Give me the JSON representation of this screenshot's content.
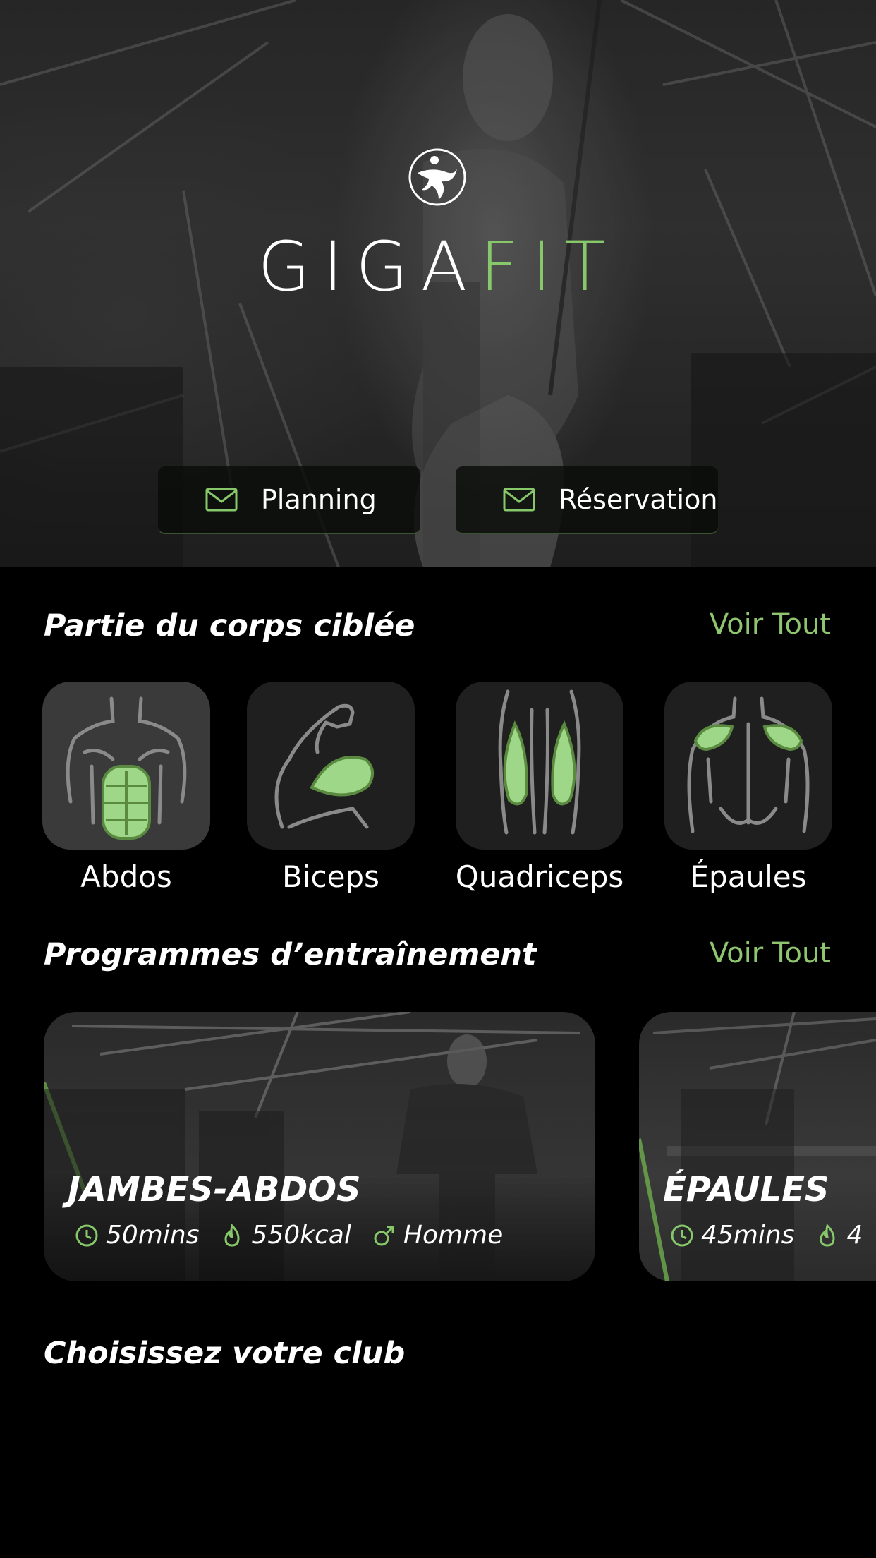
{
  "hero": {
    "brand_part1": "GIGA",
    "brand_part2": "FIT",
    "buttons": [
      {
        "label": "Planning",
        "icon": "mail-icon"
      },
      {
        "label": "Réservation",
        "icon": "mail-icon"
      }
    ]
  },
  "body_parts": {
    "title": "Partie du corps ciblée",
    "see_all": "Voir Tout",
    "items": [
      {
        "label": "Abdos",
        "icon": "abs-icon"
      },
      {
        "label": "Biceps",
        "icon": "biceps-icon"
      },
      {
        "label": "Quadriceps",
        "icon": "quadriceps-icon"
      },
      {
        "label": "Épaules",
        "icon": "shoulders-icon"
      }
    ]
  },
  "programs": {
    "title": "Programmes d’entraînement",
    "see_all": "Voir Tout",
    "items": [
      {
        "title": "JAMBES-ABDOS",
        "duration": "50mins",
        "calories": "550kcal",
        "gender": "Homme"
      },
      {
        "title": "ÉPAULES",
        "duration": "45mins",
        "calories": "4"
      }
    ]
  },
  "clubs": {
    "title": "Choisissez votre club"
  },
  "colors": {
    "accent": "#86c86a",
    "background": "#000000",
    "tile": "#1f1f1f"
  }
}
